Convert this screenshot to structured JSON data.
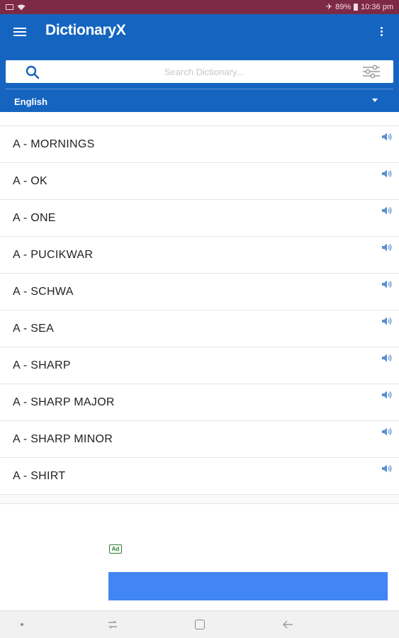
{
  "status_bar": {
    "battery": "89%",
    "time": "10:36 pm"
  },
  "app_bar": {
    "title": "DictionaryX",
    "menu_icon": "hamburger-menu-icon",
    "overflow_icon": "more-vertical-icon"
  },
  "search": {
    "placeholder": "Search Dictionary...",
    "value": "",
    "search_icon": "search-icon",
    "filter_icon": "filter-sliders-icon"
  },
  "language": {
    "selected": "English",
    "caret_icon": "caret-down-icon"
  },
  "words": [
    {
      "text": "A - MORNINGS"
    },
    {
      "text": "A - OK"
    },
    {
      "text": "A - ONE"
    },
    {
      "text": "A - PUCIKWAR"
    },
    {
      "text": "A - SCHWA"
    },
    {
      "text": "A - SEA"
    },
    {
      "text": "A - SHARP"
    },
    {
      "text": "A - SHARP MAJOR"
    },
    {
      "text": "A - SHARP MINOR"
    },
    {
      "text": "A - SHIRT"
    }
  ],
  "ad": {
    "badge": "Ad",
    "button_color": "#4285f4"
  },
  "colors": {
    "status_bar": "#7d2a47",
    "app_bar": "#1565c0",
    "speaker": "#5a8fd0"
  }
}
